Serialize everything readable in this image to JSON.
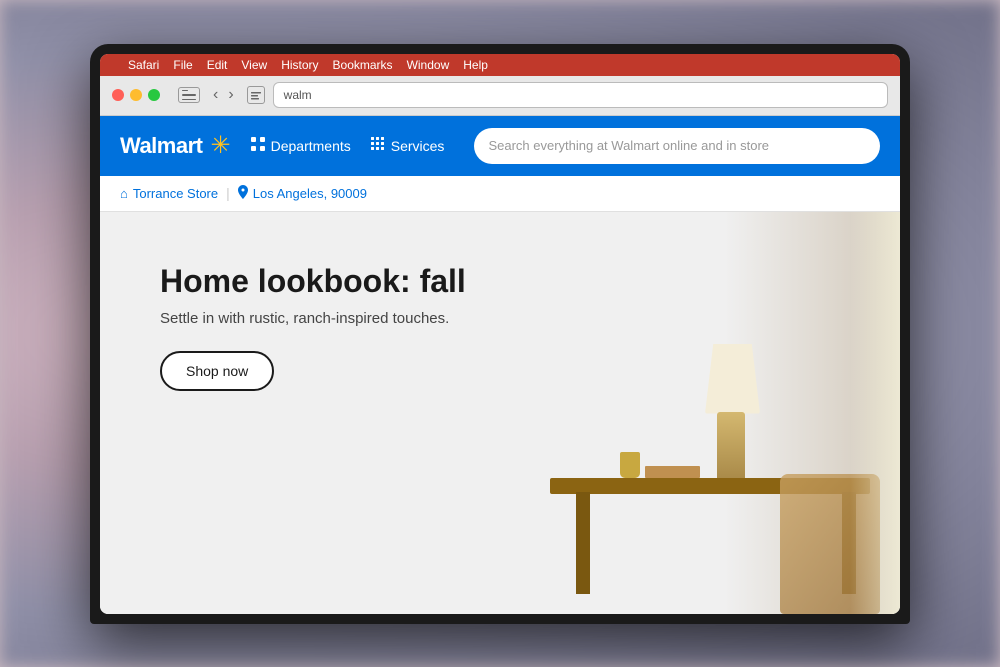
{
  "os": {
    "menu_bar": {
      "apple_symbol": "",
      "items": [
        "Safari",
        "File",
        "Edit",
        "View",
        "History",
        "Bookmarks",
        "Window",
        "Help"
      ]
    }
  },
  "browser": {
    "address": "walm",
    "back_button": "‹",
    "forward_button": "›"
  },
  "walmart": {
    "logo_text": "Walmart",
    "spark_symbol": "✳",
    "nav": {
      "departments_label": "Departments",
      "services_label": "Services",
      "search_placeholder": "Search everything at Walmart online and in store"
    },
    "location": {
      "store_icon": "⌂",
      "store_name": "Torrance Store",
      "separator": "|",
      "pin_icon": "📍",
      "location_name": "Los Angeles, 90009"
    },
    "hero": {
      "title": "Home lookbook: fall",
      "subtitle": "Settle in with rustic, ranch-inspired touches.",
      "cta_label": "Shop now"
    }
  }
}
